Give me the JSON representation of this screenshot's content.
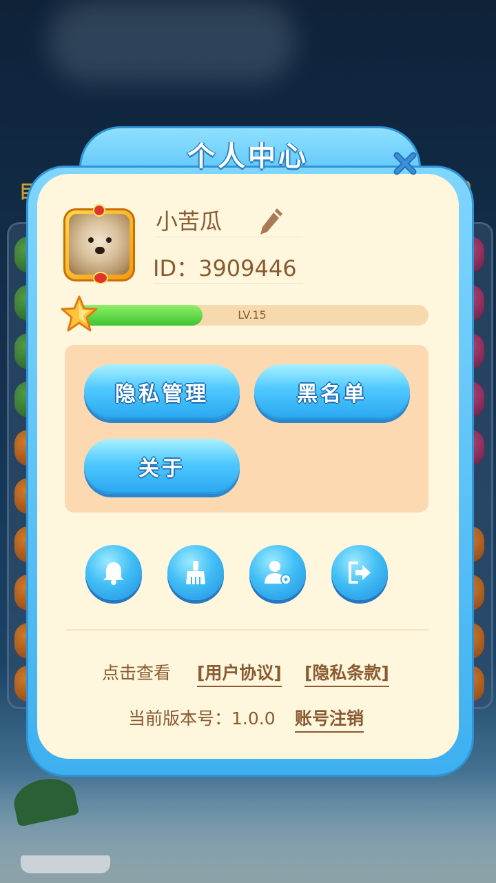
{
  "background": {
    "left_label": "目",
    "right_label": "00"
  },
  "dialog": {
    "title": "个人中心",
    "close_icon": "close-icon"
  },
  "profile": {
    "nickname": "小苦瓜",
    "user_id": "ID：3909446",
    "edit_icon": "pencil-icon",
    "avatar_icon": "dog-avatar"
  },
  "level": {
    "label": "LV.15",
    "progress_fraction": 0.36,
    "icon": "star-icon"
  },
  "menu": {
    "privacy_management": "隐私管理",
    "blacklist": "黑名单",
    "about": "关于"
  },
  "icon_buttons": [
    {
      "icon": "bell-icon"
    },
    {
      "icon": "broom-icon"
    },
    {
      "icon": "user-settings-icon"
    },
    {
      "icon": "logout-icon"
    }
  ],
  "footer": {
    "prompt": "点击查看",
    "user_agreement": "[用户协议]",
    "privacy_terms": "[隐私条款]",
    "version_text": "当前版本号：1.0.0",
    "delete_account": "账号注销"
  },
  "colors": {
    "accent_blue": "#3fb5f4",
    "card_bg": "#fef6dd",
    "text_brown": "#8a5a30",
    "progress_green": "#3fc42f"
  }
}
